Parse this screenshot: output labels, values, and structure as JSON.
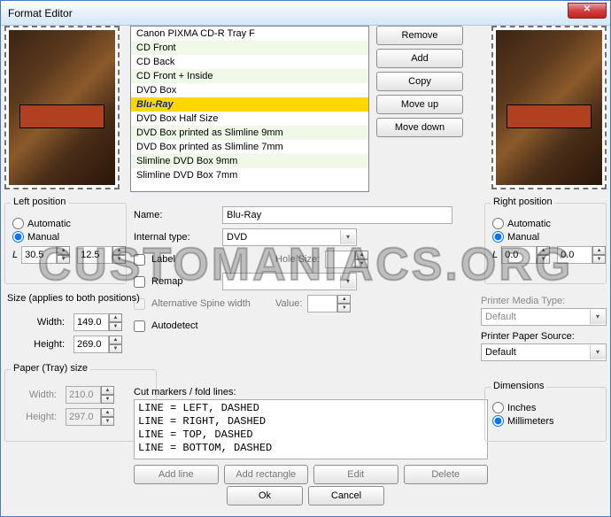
{
  "window": {
    "title": "Format Editor"
  },
  "watermark": "CUSTOMANIACS.ORG",
  "formats": [
    "Canon PIXMA CD-R Tray F",
    "CD Front",
    "CD Back",
    "CD Front + Inside",
    "DVD Box",
    "Blu-Ray",
    "DVD Box Half Size",
    "DVD Box printed as Slimline 9mm",
    "DVD Box printed as Slimline 7mm",
    "Slimline DVD Box 9mm",
    "Slimline DVD Box 7mm"
  ],
  "formats_selected_index": 5,
  "buttons": {
    "remove": "Remove",
    "add": "Add",
    "copy": "Copy",
    "moveup": "Move up",
    "movedown": "Move down",
    "addline": "Add line",
    "addrect": "Add rectangle",
    "edit": "Edit",
    "delete": "Delete",
    "ok": "Ok",
    "cancel": "Cancel"
  },
  "left_pos": {
    "title": "Left position",
    "automatic": "Automatic",
    "manual": "Manual",
    "sel": "manual",
    "L_label": "L",
    "l": "30.5",
    "t": "12.5"
  },
  "right_pos": {
    "title": "Right position",
    "automatic": "Automatic",
    "manual": "Manual",
    "sel": "manual",
    "L_label": "L",
    "l": "0.0",
    "t": "0.0"
  },
  "name": {
    "label": "Name:",
    "value": "Blu-Ray"
  },
  "internal_type": {
    "label": "Internal type:",
    "value": "DVD"
  },
  "label_ck": {
    "label": "Label",
    "checked": false
  },
  "hole_size": {
    "label": "Hole Size:",
    "value": ""
  },
  "remap_ck": {
    "label": "Remap",
    "checked": false
  },
  "remap_combo": "",
  "alt_spine": {
    "label": "Alternative Spine width",
    "checked": false
  },
  "value_field": {
    "label": "Value:",
    "value": ""
  },
  "autodetect": {
    "label": "Autodetect",
    "checked": false
  },
  "size": {
    "title": "Size (applies to both positions)",
    "width_label": "Width:",
    "width": "149.0",
    "height_label": "Height:",
    "height": "269.0"
  },
  "paper": {
    "title": "Paper (Tray) size",
    "width_label": "Width:",
    "width": "210.0",
    "height_label": "Height:",
    "height": "297.0"
  },
  "printer_media": {
    "label": "Printer Media Type:",
    "value": "Default"
  },
  "printer_source": {
    "label": "Printer Paper Source:",
    "value": "Default"
  },
  "cut": {
    "label": "Cut markers / fold lines:",
    "text": "LINE = LEFT, DASHED\nLINE = RIGHT, DASHED\nLINE = TOP, DASHED\nLINE = BOTTOM, DASHED"
  },
  "dim": {
    "title": "Dimensions",
    "inches": "Inches",
    "mm": "Millimeters",
    "sel": "mm"
  }
}
